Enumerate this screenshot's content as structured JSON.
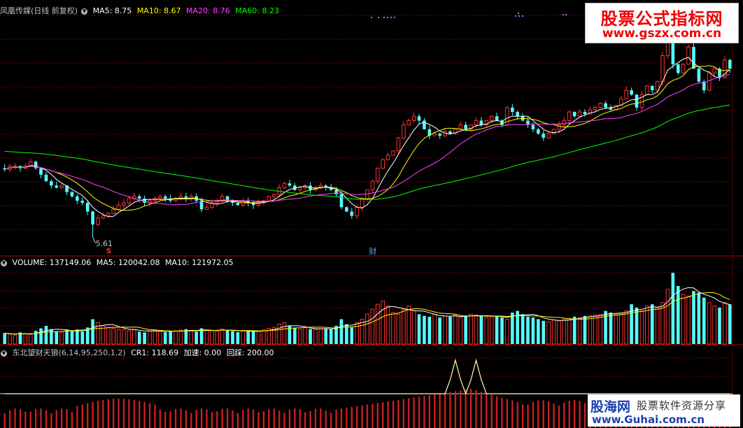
{
  "main_header": {
    "stock": "凤凰传媒(日线 前复权)",
    "items": [
      {
        "label": "MA5: 8.75",
        "color": "#ffffff"
      },
      {
        "label": "MA10: 8.67",
        "color": "#ffff00"
      },
      {
        "label": "MA20: 8.76",
        "color": "#ff40ff"
      },
      {
        "label": "MA60: 8.23",
        "color": "#00ff00"
      }
    ]
  },
  "vol_header": {
    "items": [
      {
        "label": "VOLUME: 137149.06",
        "color": "#ffffff"
      },
      {
        "label": "MA5: 120042.08",
        "color": "#ffffff"
      },
      {
        "label": "MA10: 121972.05",
        "color": "#ffffff"
      }
    ]
  },
  "ind_header": {
    "items": [
      {
        "label": "东北望财天狼(6,14,95,250,1,2)",
        "color": "#c0c0c0"
      },
      {
        "label": "CR1: 118.69",
        "color": "#ffffff"
      },
      {
        "label": "加速: 0.00",
        "color": "#ffffff"
      },
      {
        "label": "回踩: 200.00",
        "color": "#ffffff"
      }
    ]
  },
  "annotations": {
    "low_label": "5.61",
    "s_mark": "S",
    "cai_mark": "财"
  },
  "watermarks": {
    "top_title": "股票公式指标网",
    "top_url": "www.gszx.com.cn",
    "bottom_brand": "股海网",
    "bottom_slogan": "股票软件资源分享",
    "bottom_url": "www.Guhai.com.cn"
  },
  "chart_data": {
    "type": "candlestick",
    "price_range": [
      5.4,
      10.6
    ],
    "candles": [
      [
        7.2,
        7.17,
        7.29,
        7.12
      ],
      [
        7.17,
        7.25,
        7.3,
        7.11
      ],
      [
        7.25,
        7.25,
        7.32,
        7.17
      ],
      [
        7.25,
        7.2,
        7.26,
        7.12
      ],
      [
        7.2,
        7.25,
        7.32,
        7.18
      ],
      [
        7.25,
        7.35,
        7.42,
        7.23
      ],
      [
        7.35,
        7.2,
        7.38,
        7.16
      ],
      [
        7.2,
        7.05,
        7.22,
        6.97
      ],
      [
        7.05,
        6.9,
        7.11,
        6.88
      ],
      [
        6.9,
        6.8,
        6.94,
        6.73
      ],
      [
        6.8,
        6.75,
        6.89,
        6.73
      ],
      [
        6.75,
        6.8,
        6.87,
        6.72
      ],
      [
        6.8,
        6.65,
        6.81,
        6.58
      ],
      [
        6.65,
        6.55,
        6.67,
        6.52
      ],
      [
        6.55,
        6.45,
        6.6,
        6.37
      ],
      [
        6.45,
        6.4,
        6.52,
        6.35
      ],
      [
        6.4,
        6.2,
        6.44,
        6.12
      ],
      [
        6.2,
        5.9,
        6.22,
        5.61
      ],
      [
        5.9,
        6.05,
        6.13,
        5.86
      ],
      [
        6.05,
        6.1,
        6.16,
        6.02
      ],
      [
        6.1,
        6.15,
        6.2,
        6.06
      ],
      [
        6.15,
        6.25,
        6.34,
        6.14
      ],
      [
        6.25,
        6.35,
        6.44,
        6.22
      ],
      [
        6.35,
        6.4,
        6.49,
        6.27
      ],
      [
        6.4,
        6.5,
        6.56,
        6.35
      ],
      [
        6.5,
        6.55,
        6.64,
        6.43
      ],
      [
        6.55,
        6.5,
        6.6,
        6.41
      ],
      [
        6.5,
        6.4,
        6.57,
        6.33
      ],
      [
        6.4,
        6.45,
        6.5,
        6.31
      ],
      [
        6.45,
        6.5,
        6.55,
        6.38
      ],
      [
        6.5,
        6.55,
        6.6,
        6.46
      ],
      [
        6.55,
        6.5,
        6.59,
        6.42
      ],
      [
        6.5,
        6.45,
        6.59,
        6.4
      ],
      [
        6.45,
        6.5,
        6.55,
        6.42
      ],
      [
        6.5,
        6.55,
        6.63,
        6.45
      ],
      [
        6.55,
        6.5,
        6.63,
        6.42
      ],
      [
        6.5,
        6.55,
        6.61,
        6.43
      ],
      [
        6.55,
        6.45,
        6.62,
        6.39
      ],
      [
        6.45,
        6.25,
        6.52,
        6.19
      ],
      [
        6.25,
        6.3,
        6.38,
        6.24
      ],
      [
        6.3,
        6.4,
        6.48,
        6.26
      ],
      [
        6.4,
        6.45,
        6.5,
        6.32
      ],
      [
        6.45,
        6.55,
        6.61,
        6.39
      ],
      [
        6.55,
        6.45,
        6.57,
        6.4
      ],
      [
        6.45,
        6.4,
        6.48,
        6.33
      ],
      [
        6.4,
        6.35,
        6.4,
        6.33
      ],
      [
        6.35,
        6.45,
        6.52,
        6.3
      ],
      [
        6.45,
        6.4,
        6.52,
        6.32
      ],
      [
        6.4,
        6.35,
        6.44,
        6.26
      ],
      [
        6.35,
        6.4,
        6.48,
        6.3
      ],
      [
        6.4,
        6.45,
        6.47,
        6.36
      ],
      [
        6.45,
        6.55,
        6.57,
        6.47
      ],
      [
        6.55,
        6.6,
        6.61,
        6.47
      ],
      [
        6.6,
        6.75,
        6.83,
        6.53
      ],
      [
        6.75,
        6.85,
        6.88,
        6.71
      ],
      [
        6.85,
        6.8,
        6.93,
        6.76
      ],
      [
        6.8,
        6.7,
        6.86,
        6.67
      ],
      [
        6.7,
        6.75,
        6.8,
        6.62
      ],
      [
        6.75,
        6.8,
        6.84,
        6.69
      ],
      [
        6.8,
        6.7,
        6.88,
        6.61
      ],
      [
        6.7,
        6.75,
        6.8,
        6.66
      ],
      [
        6.75,
        6.8,
        6.87,
        6.71
      ],
      [
        6.8,
        6.75,
        6.83,
        6.68
      ],
      [
        6.75,
        6.7,
        6.84,
        6.67
      ],
      [
        6.7,
        6.6,
        6.77,
        6.54
      ],
      [
        6.6,
        6.3,
        6.67,
        6.25
      ],
      [
        6.3,
        6.2,
        6.32,
        6.19
      ],
      [
        6.2,
        6.1,
        6.28,
        6.03
      ],
      [
        6.1,
        6.3,
        6.38,
        6.03
      ],
      [
        6.3,
        6.5,
        6.53,
        6.21
      ],
      [
        6.5,
        6.7,
        6.71,
        6.45
      ],
      [
        6.7,
        6.9,
        6.94,
        6.62
      ],
      [
        6.9,
        7.2,
        7.22,
        6.83
      ],
      [
        7.2,
        7.4,
        7.42,
        7.18
      ],
      [
        7.4,
        7.5,
        7.56,
        7.38
      ],
      [
        7.5,
        7.6,
        7.61,
        7.49
      ],
      [
        7.6,
        7.9,
        7.93,
        7.54
      ],
      [
        7.9,
        8.2,
        8.29,
        7.86
      ],
      [
        8.2,
        8.3,
        8.35,
        8.19
      ],
      [
        8.3,
        8.4,
        8.49,
        8.25
      ],
      [
        8.4,
        8.3,
        8.45,
        8.21
      ],
      [
        8.3,
        8.1,
        8.36,
        8.09
      ],
      [
        8.1,
        7.95,
        8.18,
        7.87
      ],
      [
        7.95,
        8.0,
        8.06,
        7.94
      ],
      [
        8.0,
        7.95,
        8.02,
        7.88
      ],
      [
        7.95,
        8.05,
        8.11,
        7.92
      ],
      [
        8.05,
        8.0,
        8.08,
        7.98
      ],
      [
        8.0,
        8.1,
        8.12,
        7.97
      ],
      [
        8.1,
        8.2,
        8.28,
        8.06
      ],
      [
        8.2,
        8.1,
        8.27,
        8.06
      ],
      [
        8.1,
        8.2,
        8.21,
        8.05
      ],
      [
        8.2,
        8.3,
        8.38,
        8.14
      ],
      [
        8.3,
        8.2,
        8.38,
        8.16
      ],
      [
        8.2,
        8.3,
        8.31,
        8.15
      ],
      [
        8.3,
        8.4,
        8.42,
        8.24
      ],
      [
        8.4,
        8.3,
        8.48,
        8.28
      ],
      [
        8.3,
        8.2,
        8.33,
        8.15
      ],
      [
        8.2,
        8.6,
        8.64,
        8.18
      ],
      [
        8.6,
        8.5,
        8.68,
        8.42
      ],
      [
        8.5,
        8.4,
        8.53,
        8.32
      ],
      [
        8.4,
        8.3,
        8.47,
        8.28
      ],
      [
        8.3,
        8.2,
        8.38,
        8.13
      ],
      [
        8.2,
        8.1,
        8.26,
        8.03
      ],
      [
        8.1,
        8.0,
        8.13,
        7.97
      ],
      [
        8.0,
        7.9,
        8.07,
        7.83
      ],
      [
        7.9,
        8.0,
        8.06,
        7.88
      ],
      [
        8.0,
        8.1,
        8.11,
        8.0
      ],
      [
        8.1,
        8.2,
        8.29,
        8.01
      ],
      [
        8.2,
        8.3,
        8.39,
        8.13
      ],
      [
        8.3,
        8.5,
        8.53,
        8.23
      ],
      [
        8.5,
        8.4,
        8.51,
        8.36
      ],
      [
        8.4,
        8.5,
        8.56,
        8.45
      ],
      [
        8.5,
        8.45,
        8.56,
        8.39
      ],
      [
        8.45,
        8.55,
        8.62,
        8.44
      ],
      [
        8.55,
        8.6,
        8.65,
        8.49
      ],
      [
        8.6,
        8.7,
        8.73,
        8.65
      ],
      [
        8.7,
        8.6,
        8.75,
        8.57
      ],
      [
        8.6,
        8.55,
        8.67,
        8.53
      ],
      [
        8.55,
        8.65,
        8.67,
        8.54
      ],
      [
        8.65,
        8.8,
        8.87,
        8.73
      ],
      [
        8.8,
        9.0,
        9.09,
        8.92
      ],
      [
        9.0,
        8.9,
        9.06,
        8.87
      ],
      [
        8.9,
        8.6,
        8.91,
        8.53
      ],
      [
        8.6,
        8.9,
        8.98,
        8.53
      ],
      [
        8.9,
        9.1,
        9.12,
        8.9
      ],
      [
        9.1,
        9.0,
        9.12,
        8.93
      ],
      [
        9.0,
        9.2,
        9.22,
        8.94
      ],
      [
        9.2,
        9.8,
        9.89,
        9.1
      ],
      [
        9.8,
        10.2,
        10.26,
        9.73
      ],
      [
        10.2,
        9.6,
        10.25,
        9.5
      ],
      [
        9.6,
        9.4,
        9.62,
        9.35
      ],
      [
        9.4,
        9.6,
        9.62,
        9.37
      ],
      [
        9.6,
        10.0,
        10.06,
        9.59
      ],
      [
        10.0,
        9.5,
        10.09,
        9.49
      ],
      [
        9.5,
        9.2,
        9.54,
        9.17
      ],
      [
        9.2,
        9.0,
        9.25,
        8.93
      ],
      [
        9.0,
        9.4,
        9.44,
        8.98
      ],
      [
        9.4,
        9.5,
        9.53,
        9.31
      ],
      [
        9.5,
        9.3,
        9.53,
        9.21
      ],
      [
        9.3,
        9.7,
        9.79,
        9.26
      ],
      [
        9.7,
        9.5,
        9.73,
        9.4
      ]
    ],
    "volume": [
      66,
      60,
      55,
      70,
      62,
      58,
      80,
      95,
      110,
      90,
      75,
      70,
      85,
      80,
      88,
      75,
      100,
      150,
      130,
      110,
      100,
      95,
      90,
      85,
      80,
      88,
      75,
      70,
      80,
      85,
      78,
      72,
      76,
      80,
      85,
      90,
      82,
      75,
      95,
      85,
      80,
      78,
      90,
      85,
      78,
      72,
      80,
      76,
      80,
      78,
      85,
      95,
      100,
      120,
      130,
      110,
      95,
      90,
      100,
      90,
      88,
      92,
      95,
      90,
      110,
      150,
      120,
      100,
      130,
      150,
      180,
      210,
      240,
      260,
      230,
      190,
      180,
      210,
      230,
      200,
      180,
      170,
      165,
      180,
      160,
      170,
      165,
      175,
      160,
      170,
      180,
      175,
      170,
      160,
      165,
      170,
      160,
      150,
      190,
      200,
      180,
      165,
      160,
      150,
      140,
      135,
      145,
      140,
      150,
      155,
      165,
      160,
      170,
      170,
      175,
      180,
      200,
      190,
      180,
      185,
      200,
      240,
      220,
      200,
      230,
      240,
      220,
      250,
      330,
      430,
      350,
      300,
      290,
      320,
      310,
      280,
      250,
      230,
      220,
      250,
      240
    ],
    "volume_range": [
      0,
      430
    ],
    "cr1_range": [
      0,
      200
    ],
    "cr1_last": 118.69
  }
}
